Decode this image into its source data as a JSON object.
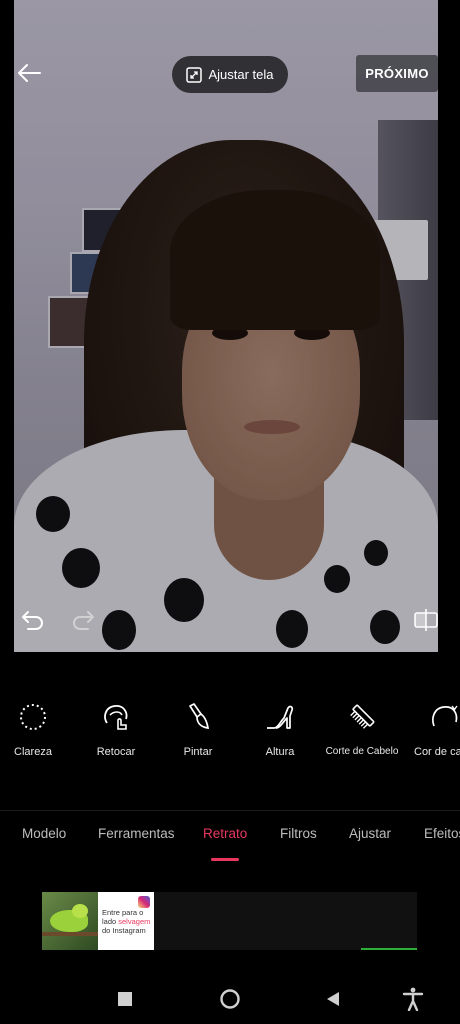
{
  "header": {
    "fit_label": "Ajustar tela",
    "next_label": "PRÓXIMO"
  },
  "tools": [
    {
      "label": "Clareza",
      "icon": "dotted-circle-icon"
    },
    {
      "label": "Retocar",
      "icon": "touch-face-icon"
    },
    {
      "label": "Pintar",
      "icon": "brush-icon"
    },
    {
      "label": "Altura",
      "icon": "high-heel-icon"
    },
    {
      "label": "Corte de Cabelo",
      "icon": "comb-icon"
    },
    {
      "label": "Cor de cab",
      "icon": "hair-color-icon"
    }
  ],
  "tabs": [
    {
      "label": "Modelo",
      "active": false
    },
    {
      "label": "Ferramentas",
      "active": false
    },
    {
      "label": "Retrato",
      "active": true
    },
    {
      "label": "Filtros",
      "active": false
    },
    {
      "label": "Ajustar",
      "active": false
    },
    {
      "label": "Efeitos",
      "active": false
    }
  ],
  "ad": {
    "line1": "Entre para o",
    "line2a": "lado ",
    "line2b": "selvagem",
    "line3": "do Instagram",
    "progress": 0.15
  },
  "colors": {
    "accent": "#e8385f",
    "background": "#000000"
  }
}
